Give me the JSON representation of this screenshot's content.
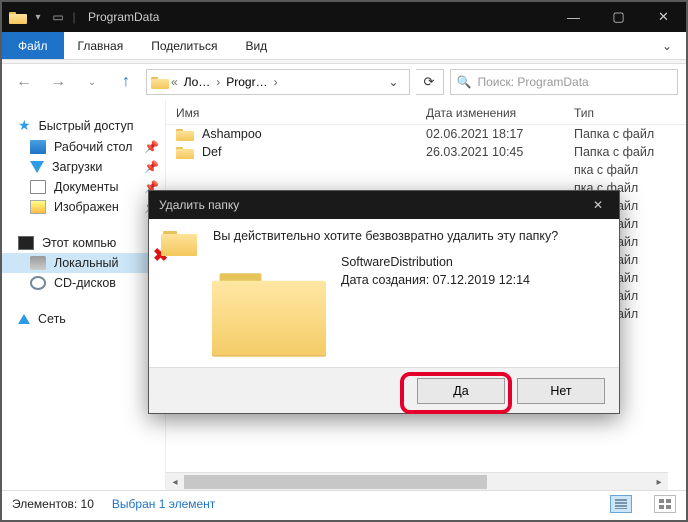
{
  "window": {
    "title": "ProgramData"
  },
  "ribbon": {
    "file": "Файл",
    "tabs": [
      "Главная",
      "Поделиться",
      "Вид"
    ]
  },
  "address": {
    "crumb1": "Ло…",
    "crumb2": "Progr…",
    "search_placeholder": "Поиск: ProgramData"
  },
  "columns": {
    "name": "Имя",
    "date": "Дата изменения",
    "type": "Тип"
  },
  "sidebar": {
    "quick": "Быстрый доступ",
    "items": [
      "Рабочий стол",
      "Загрузки",
      "Документы",
      "Изображен"
    ],
    "pc": "Этот компью",
    "local": "Локальный",
    "cd": "CD-дисков",
    "net": "Сеть"
  },
  "rows": [
    {
      "name": "Ashampoo",
      "date": "02.06.2021 18:17",
      "type": "Папка с файл"
    },
    {
      "name": "Def",
      "date": "26.03.2021 10:45",
      "type": "Папка с файл"
    }
  ],
  "peek_rows": [
    "пка с файл",
    "пка с файл",
    "пка с файл",
    "пка с файл",
    "пка с файл",
    "пка с файл",
    "пка с файл",
    "пка с файл",
    "пка с файл"
  ],
  "status": {
    "count": "Элементов: 10",
    "selected": "Выбран 1 элемент"
  },
  "dialog": {
    "title": "Удалить папку",
    "message": "Вы действительно хотите безвозвратно удалить эту папку?",
    "target_name": "SoftwareDistribution",
    "target_date": "Дата создания: 07.12.2019 12:14",
    "yes": "Да",
    "no": "Нет"
  }
}
